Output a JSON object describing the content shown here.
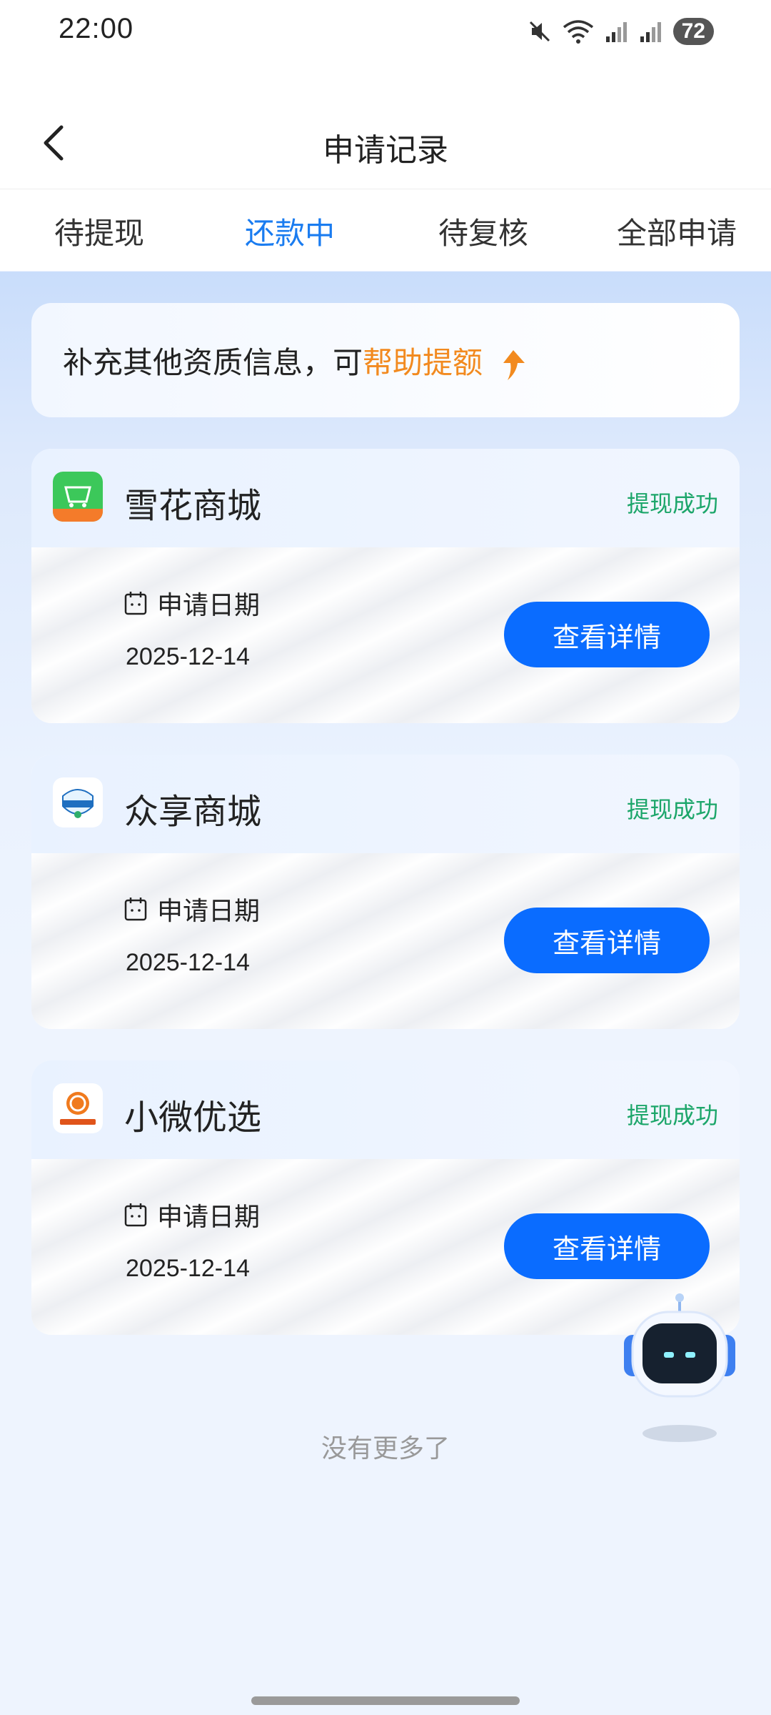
{
  "status_bar": {
    "time": "22:00",
    "battery": "72"
  },
  "navbar": {
    "title": "申请记录"
  },
  "tabs": [
    {
      "label": "待提现",
      "active": false
    },
    {
      "label": "还款中",
      "active": true
    },
    {
      "label": "待复核",
      "active": false
    },
    {
      "label": "全部申请",
      "active": false
    }
  ],
  "banner": {
    "text": "补充其他资质信息，可",
    "highlight": "帮助提额"
  },
  "records": [
    {
      "shop_name": "雪花商城",
      "logo_text": "雪花商城",
      "status": "提现成功",
      "date_label": "申请日期",
      "date": "2025-12-14",
      "button": "查看详情"
    },
    {
      "shop_name": "众享商城",
      "logo_text": "众享商城",
      "status": "提现成功",
      "date_label": "申请日期",
      "date": "2025-12-14",
      "button": "查看详情"
    },
    {
      "shop_name": "小微优选",
      "logo_text": "小微优选",
      "status": "提现成功",
      "date_label": "申请日期",
      "date": "2025-12-14",
      "button": "查看详情"
    }
  ],
  "footer": {
    "no_more": "没有更多了"
  },
  "colors": {
    "accent": "#0a6cff",
    "success": "#1ca66a",
    "highlight": "#f28a1f",
    "active_tab": "#1a7cf0"
  },
  "icons": [
    "back-arrow-icon",
    "mute-icon",
    "wifi-icon",
    "signal-icon",
    "calendar-icon",
    "up-arrow-icon",
    "robot-assistant-icon"
  ]
}
